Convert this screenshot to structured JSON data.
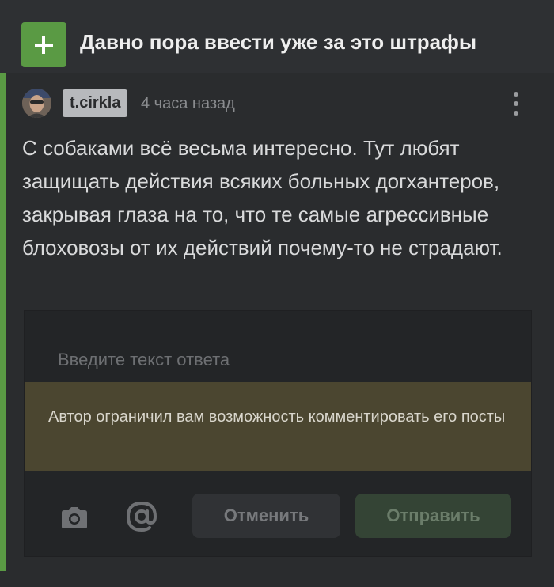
{
  "header": {
    "expand_icon": "plus-icon",
    "title": "Давно пора ввести уже за это штрафы"
  },
  "comment": {
    "avatar_icon": "user-avatar",
    "username": "t.cirkla",
    "timestamp": "4 часа назад",
    "more_icon": "more-vertical-icon",
    "text": "С собаками всё весьма интересно. Тут любят защищать действия всяких больных догхантеров, закрывая глаза на то, что те самые агрессивные блоховозы от их действий почему-то не страдают."
  },
  "reply_form": {
    "placeholder": "Введите текст ответа",
    "restriction_notice": "Автор ограничил вам возможность комментировать его посты",
    "camera_icon": "camera-icon",
    "mention_icon": "at-icon",
    "cancel_label": "Отменить",
    "send_label": "Отправить"
  },
  "colors": {
    "accent": "#5a9a44",
    "background": "#2a2c2e",
    "notice_background": "#4b4630"
  }
}
